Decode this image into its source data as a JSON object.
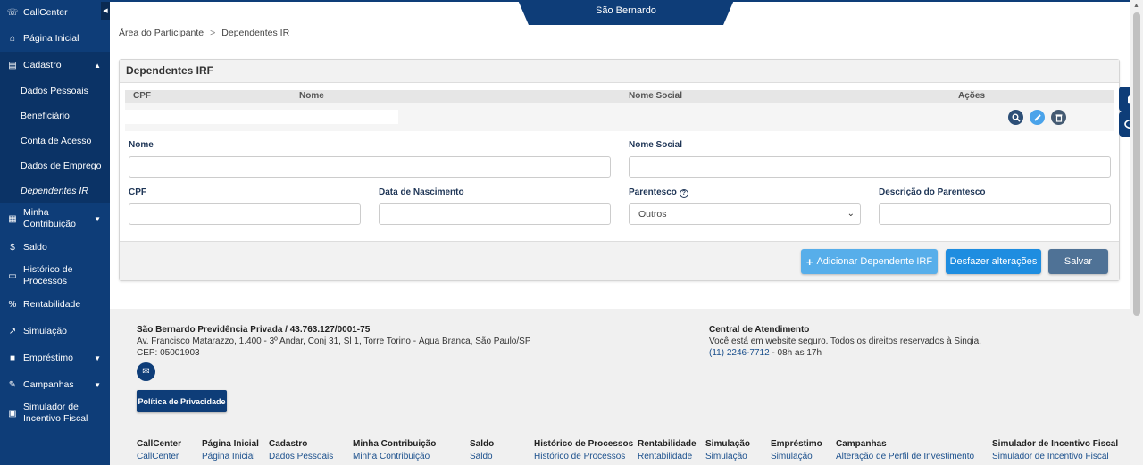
{
  "sidebar": {
    "items": [
      {
        "label": "CallCenter",
        "icon": "headset-icon"
      },
      {
        "label": "Página Inicial",
        "icon": "bank-icon"
      },
      {
        "label": "Cadastro",
        "icon": "id-card-icon"
      },
      {
        "label": "Minha Contribuição",
        "icon": "calculator-icon"
      },
      {
        "label": "Saldo",
        "icon": "dollar-icon"
      },
      {
        "label": "Histórico de Processos",
        "icon": "document-icon"
      },
      {
        "label": "Rentabilidade",
        "icon": "percent-icon"
      },
      {
        "label": "Simulação",
        "icon": "chart-icon"
      },
      {
        "label": "Empréstimo",
        "icon": "briefcase-icon"
      },
      {
        "label": "Campanhas",
        "icon": "edit-icon"
      },
      {
        "label": "Simulador de Incentivo Fiscal",
        "icon": "money-icon"
      }
    ],
    "cadastro_sub": [
      "Dados Pessoais",
      "Beneficiário",
      "Conta de Acesso",
      "Dados de Emprego",
      "Dependentes IR"
    ]
  },
  "header": {
    "brand": "São Bernardo"
  },
  "breadcrumb": {
    "root": "Área do Participante",
    "sep": ">",
    "current": "Dependentes IR"
  },
  "panel": {
    "title": "Dependentes IRF",
    "columns": [
      "CPF",
      "Nome",
      "Nome Social",
      "Ações"
    ],
    "form": {
      "nome_label": "Nome",
      "nome_social_label": "Nome Social",
      "cpf_label": "CPF",
      "nascimento_label": "Data de Nascimento",
      "parentesco_label": "Parentesco",
      "parentesco_value": "Outros",
      "descricao_label": "Descrição do Parentesco"
    },
    "buttons": {
      "add": "Adicionar Dependente IRF",
      "undo": "Desfazer alterações",
      "save": "Salvar"
    }
  },
  "footer": {
    "company": "São Bernardo Previdência Privada / 43.763.127/0001-75",
    "address": "Av. Francisco Matarazzo, 1.400 - 3º Andar, Conj 31, Sl 1, Torre Torino - Água Branca, São Paulo/SP",
    "cep": "CEP: 05001903",
    "privacy": "Política de Privacidade",
    "central_title": "Central de Atendimento",
    "central_text": "Você está em website seguro. Todos os direitos reservados à Sinqia.",
    "phone": "(11) 2246-7712",
    "hours": " - 08h as 17h",
    "columns": [
      {
        "title": "CallCenter",
        "link": "CallCenter"
      },
      {
        "title": "Página Inicial",
        "link": "Página Inicial"
      },
      {
        "title": "Cadastro",
        "link": "Dados Pessoais"
      },
      {
        "title": "Minha Contribuição",
        "link": "Minha Contribuição"
      },
      {
        "title": "Saldo",
        "link": "Saldo"
      },
      {
        "title": "Histórico de Processos",
        "link": "Histórico de Processos"
      },
      {
        "title": "Rentabilidade",
        "link": "Rentabilidade"
      },
      {
        "title": "Simulação",
        "link": "Simulação"
      },
      {
        "title": "Empréstimo",
        "link": "Simulação"
      },
      {
        "title": "Campanhas",
        "link": "Alteração de Perfil de Investimento"
      },
      {
        "title": "Simulador de Incentivo Fiscal",
        "link": "Simulador de Incentivo Fiscal"
      }
    ]
  }
}
